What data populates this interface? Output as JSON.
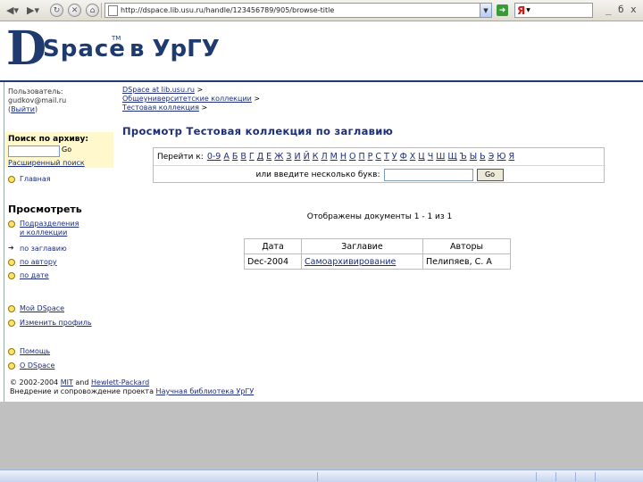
{
  "browser": {
    "url": "http://dspace.lib.usu.ru/handle/123456789/905/browse-title",
    "search_logo": "Я",
    "window_controls": [
      "_",
      "б",
      "x"
    ]
  },
  "banner": {
    "logo_d": "D",
    "logo_space": "Space",
    "logo_tm": "TM",
    "logo_suffix": "в УрГУ"
  },
  "nav": {
    "user_label": "Пользователь:",
    "user_email": "gudkov@mail.ru",
    "logout": "Выйти",
    "search_label": "Поиск по архиву:",
    "search_go": "Go",
    "advanced_search": "Расширенный поиск",
    "home": "Главная",
    "browse_heading": "Просмотреть",
    "browse_communities_1": "Подразделения",
    "browse_communities_2": "и коллекции",
    "by_title": "по заглавию",
    "by_author": "по автору",
    "by_date": "по дате",
    "my_dspace": "Мой DSpace",
    "edit_profile": "Изменить профиль",
    "help": "Помощь",
    "about": "О DSpace"
  },
  "breadcrumbs": {
    "item1": "DSpace at lib.usu.ru",
    "item2": "Общеуниверситетские коллекции",
    "item3": "Тестовая коллекция",
    "sep": ">"
  },
  "page_title": "Просмотр Тестовая коллекция по заглавию",
  "jump": {
    "label": "Перейти к:",
    "letters": [
      "0-9",
      "А",
      "Б",
      "В",
      "Г",
      "Д",
      "Е",
      "Ж",
      "З",
      "И",
      "Й",
      "К",
      "Л",
      "М",
      "Н",
      "О",
      "П",
      "Р",
      "С",
      "Т",
      "У",
      "Ф",
      "Х",
      "Ц",
      "Ч",
      "Ш",
      "Щ",
      "Ъ",
      "Ы",
      "Ь",
      "Э",
      "Ю",
      "Я"
    ],
    "or_label": "или введите несколько букв:",
    "go": "Go"
  },
  "showing": "Отображены документы 1 - 1 из 1",
  "table": {
    "headers": [
      "Дата",
      "Заглавие",
      "Авторы"
    ],
    "rows": [
      {
        "date": "Dec-2004",
        "title": "Самоархивирование",
        "authors": "Пелипяев, С. А"
      }
    ]
  },
  "footer": {
    "line1_prefix": "© 2002-2004",
    "mit": "MIT",
    "and": "and",
    "hp": "Hewlett-Packard",
    "line2_prefix": "Внедрение и сопровождение проекта",
    "library": "Научная библиотека УрГУ"
  }
}
